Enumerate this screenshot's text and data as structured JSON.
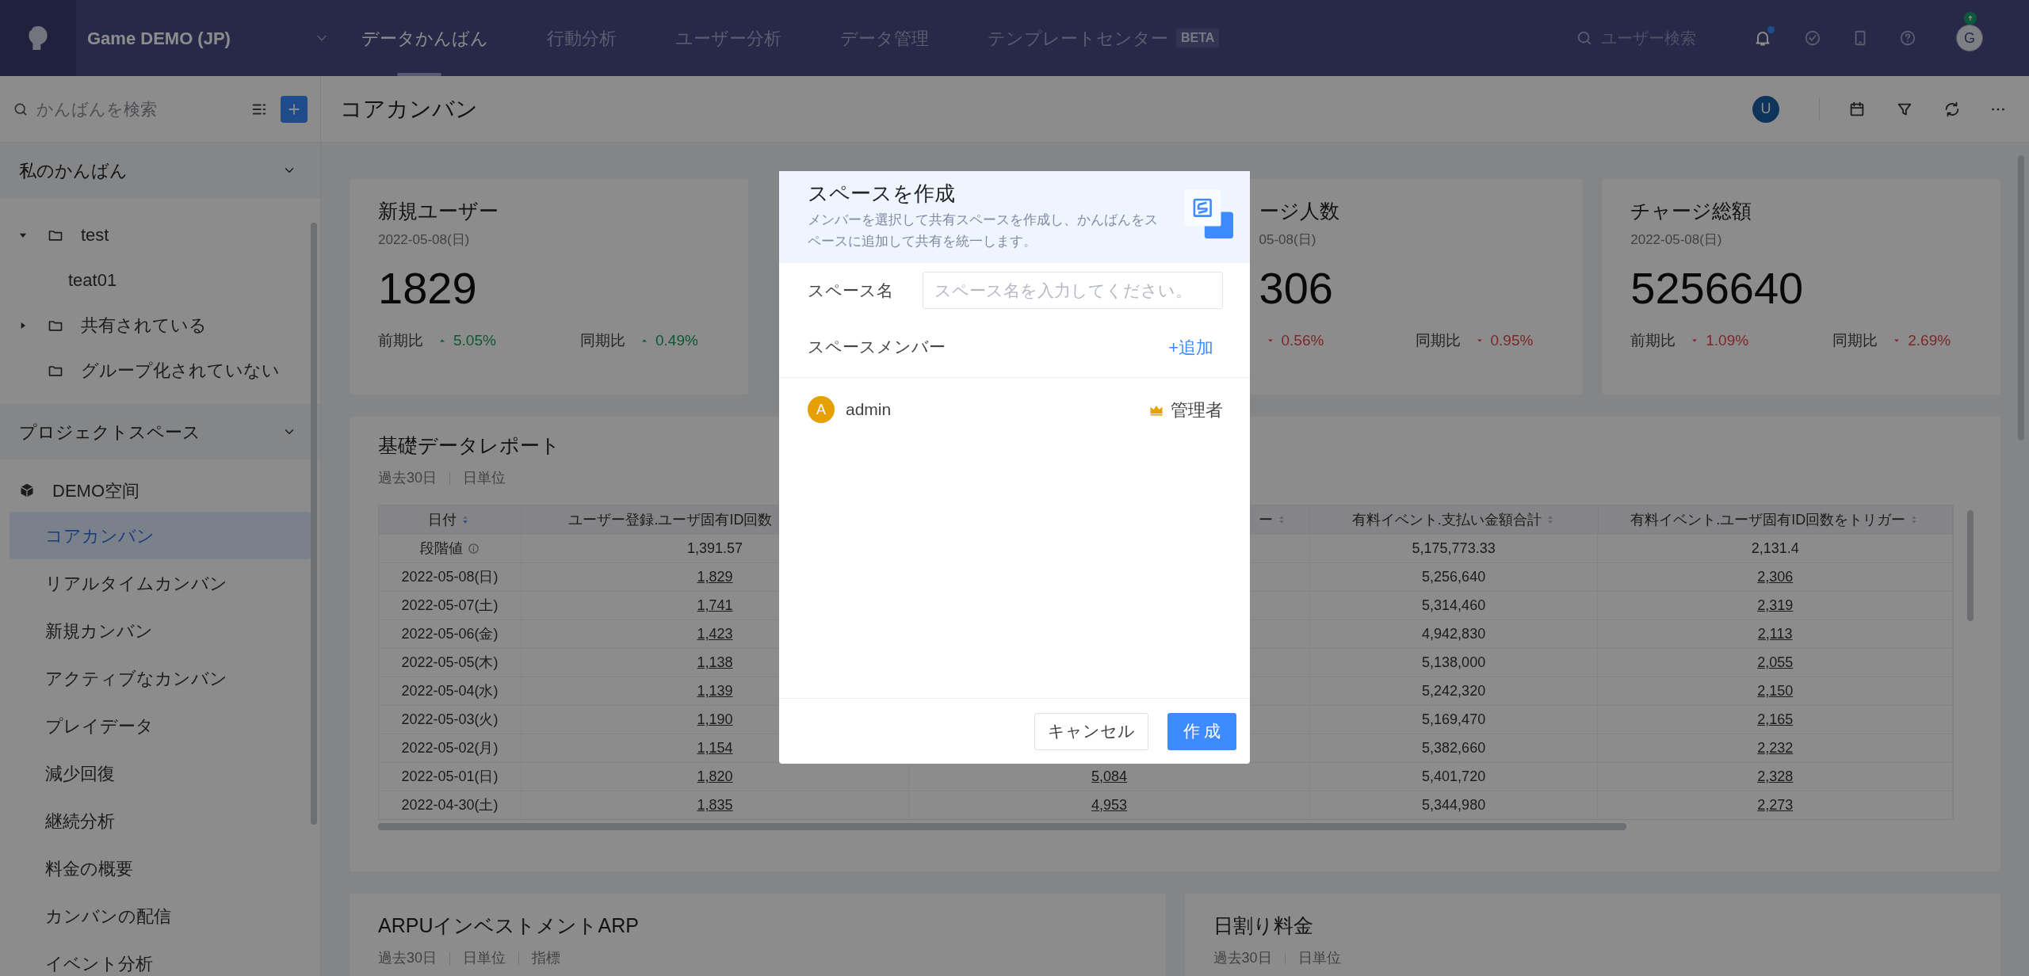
{
  "topbar": {
    "project": "Game DEMO (JP)",
    "nav": [
      {
        "label": "データかんばん",
        "selected": true
      },
      {
        "label": "行動分析",
        "selected": false
      },
      {
        "label": "ユーザー分析",
        "selected": false
      },
      {
        "label": "データ管理",
        "selected": false
      },
      {
        "label": "テンプレートセンター",
        "selected": false,
        "badge": "BETA"
      }
    ],
    "search": {
      "placeholder": "ユーザー検索"
    },
    "has_unread": true,
    "user": {
      "initial": "G"
    }
  },
  "sidebar": {
    "search": {
      "placeholder": "かんばんを検索"
    },
    "sections": [
      {
        "title": "私のかんばん",
        "expanded": true,
        "tree": [
          {
            "label": "test",
            "kind": "folder",
            "expanded": true,
            "children": [
              {
                "label": "teat01",
                "kind": "board"
              }
            ]
          },
          {
            "label": "共有されている",
            "kind": "folder",
            "expanded": false
          },
          {
            "label": "グループ化されていない",
            "kind": "folder"
          }
        ]
      },
      {
        "title": "プロジェクトスペース",
        "expanded": true,
        "tree": [
          {
            "label": "DEMO空间",
            "kind": "space",
            "children": [
              {
                "label": "コアカンバン",
                "selected": true
              },
              {
                "label": "リアルタイムカンバン",
                "selected": false
              },
              {
                "label": "新規カンバン",
                "selected": false
              },
              {
                "label": "アクティブなカンバン",
                "selected": false
              },
              {
                "label": "プレイデータ",
                "selected": false
              },
              {
                "label": "減少回復",
                "selected": false
              },
              {
                "label": "継続分析",
                "selected": false
              },
              {
                "label": "料金の概要",
                "selected": false
              },
              {
                "label": "カンバンの配信",
                "selected": false
              },
              {
                "label": "イベント分析",
                "selected": false
              }
            ]
          }
        ]
      }
    ]
  },
  "page": {
    "title": "コアカンバン",
    "viewer": {
      "initial": "U"
    }
  },
  "cards": [
    {
      "title": "新規ユーザー",
      "date": "2022-05-08(日)",
      "value": "1829",
      "covered": false,
      "compares": [
        {
          "label": "前期比",
          "rising": true,
          "value": "5.05%"
        },
        {
          "label": "同期比",
          "rising": true,
          "value": "0.49%"
        }
      ]
    },
    {
      "title": "ージ人数",
      "date": "05-08(日)",
      "value": "306",
      "covered": true,
      "compares": [
        {
          "rising": false,
          "value": "0.56%"
        },
        {
          "label": "同期比",
          "rising": false,
          "value": "0.95%"
        }
      ]
    },
    {
      "title": "チャージ総額",
      "date": "2022-05-08(日)",
      "value": "5256640",
      "covered": false,
      "compares": [
        {
          "label": "前期比",
          "rising": false,
          "value": "1.09%"
        },
        {
          "label": "同期比",
          "rising": false,
          "value": "2.69%"
        }
      ]
    }
  ],
  "report": {
    "title": "基礎データレポート",
    "tags": [
      "過去30日",
      "日単位"
    ],
    "columns": [
      {
        "label": "日付",
        "sorted_desc": true
      },
      {
        "label": "ユーザー登録.ユーザ固有ID回数"
      },
      {
        "label": "ー",
        "sorted_desc": false
      },
      {
        "label": "有料イベント.支払い金額合計",
        "sorted_desc": false
      },
      {
        "label": "有料イベント.ユーザ固有ID回数をトリガー",
        "sorted_desc": false
      }
    ],
    "rows": [
      {
        "kind": "baseline",
        "cells": [
          "段階値",
          "1,391.57",
          null,
          "5,175,773.33",
          "2,131.4"
        ]
      },
      {
        "kind": "day",
        "cells": [
          "2022-05-08(日)",
          "1,829",
          null,
          "5,256,640",
          "2,306"
        ]
      },
      {
        "kind": "day",
        "cells": [
          "2022-05-07(土)",
          "1,741",
          null,
          "5,314,460",
          "2,319"
        ]
      },
      {
        "kind": "day",
        "cells": [
          "2022-05-06(金)",
          "1,423",
          null,
          "4,942,830",
          "2,113"
        ]
      },
      {
        "kind": "day",
        "cells": [
          "2022-05-05(木)",
          "1,138",
          null,
          "5,138,000",
          "2,055"
        ]
      },
      {
        "kind": "day",
        "cells": [
          "2022-05-04(水)",
          "1,139",
          null,
          "5,242,320",
          "2,150"
        ]
      },
      {
        "kind": "day",
        "cells": [
          "2022-05-03(火)",
          "1,190",
          null,
          "5,169,470",
          "2,165"
        ]
      },
      {
        "kind": "day",
        "cells": [
          "2022-05-02(月)",
          "1,154",
          null,
          "5,382,660",
          "2,232"
        ]
      },
      {
        "kind": "day",
        "cells": [
          "2022-05-01(日)",
          "1,820",
          "5,084",
          "5,401,720",
          "2,328"
        ]
      },
      {
        "kind": "day",
        "cells": [
          "2022-04-30(土)",
          "1,835",
          "4,953",
          "5,344,980",
          "2,273"
        ]
      }
    ]
  },
  "panels": [
    {
      "title": "ARPUインベストメントARP",
      "tags": [
        "過去30日",
        "日単位",
        "指標"
      ]
    },
    {
      "title": "日割り料金",
      "tags": [
        "過去30日",
        "日単位"
      ]
    }
  ],
  "modal": {
    "title": "スペースを作成",
    "description": "メンバーを選択して共有スペースを作成し、かんばんをスペースに追加して共有を統一します。",
    "name_label": "スペース名",
    "name_placeholder": "スペース名を入力してください。",
    "members_label": "スペースメンバー",
    "add_link": "+追加",
    "members": [
      {
        "initial": "A",
        "name": "admin",
        "role": "管理者"
      }
    ],
    "cancel": "キャンセル",
    "create": "作 成"
  }
}
